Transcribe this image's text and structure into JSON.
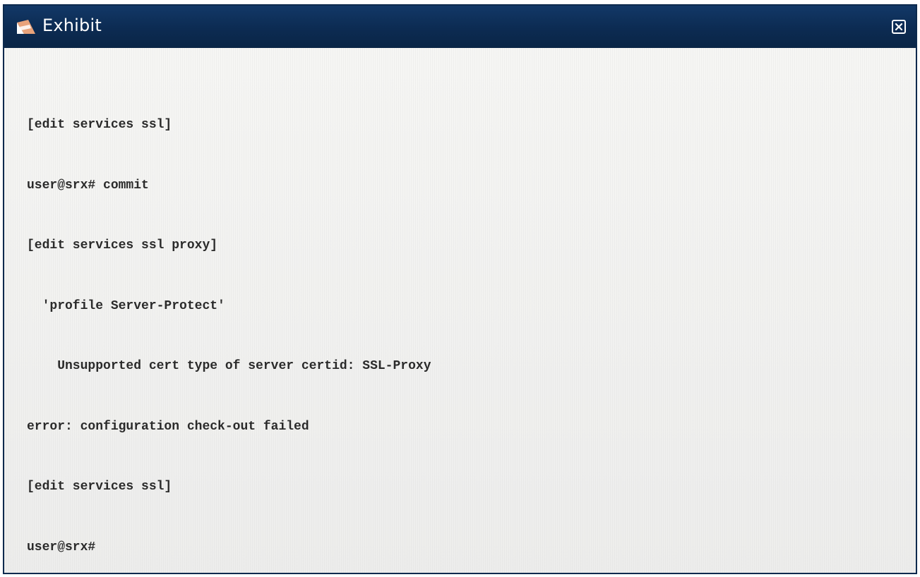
{
  "window": {
    "title": "Exhibit",
    "icon": "exhibit-app-icon",
    "close_icon": "close-icon"
  },
  "console": {
    "lines": [
      "[edit services ssl]",
      "user@srx# commit",
      "[edit services ssl proxy]",
      "  'profile Server-Protect'",
      "    Unsupported cert type of server certid: SSL-Proxy",
      "error: configuration check-out failed",
      "[edit services ssl]",
      "user@srx#"
    ]
  },
  "colors": {
    "titlebar": "#0c2b52",
    "title_text": "#ffffff",
    "content_bg": "#f2f2f1",
    "console_text": "#2a2a2a",
    "icon_accent": "#e8a27a"
  }
}
